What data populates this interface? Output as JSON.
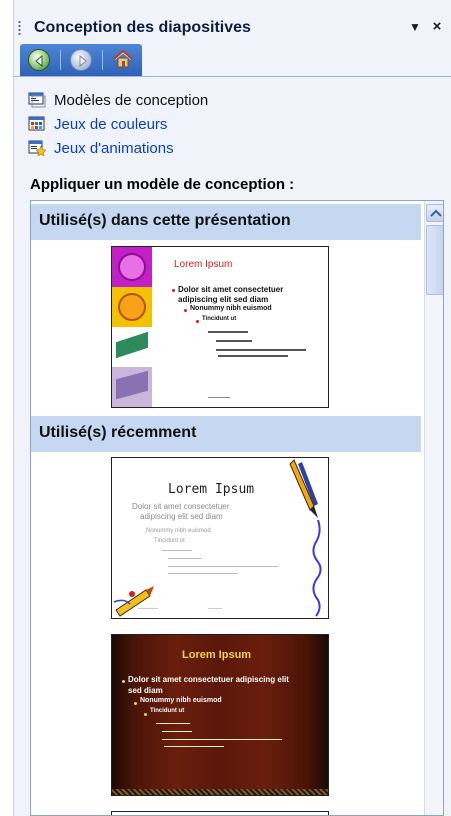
{
  "pane": {
    "title": "Conception des diapositives",
    "dropdown_icon": "dropdown-arrow-icon",
    "close_icon": "close-icon",
    "close_glyph": "×",
    "dropdown_glyph": "▼"
  },
  "nav": {
    "buttons": [
      {
        "name": "back",
        "icon": "back-arrow-icon"
      },
      {
        "name": "forward",
        "icon": "forward-arrow-icon"
      },
      {
        "name": "home",
        "icon": "home-icon"
      }
    ]
  },
  "links": [
    {
      "label": "Modèles de conception",
      "icon": "design-templates-icon"
    },
    {
      "label": "Jeux de couleurs",
      "icon": "color-schemes-icon"
    },
    {
      "label": "Jeux d'animations",
      "icon": "animation-schemes-icon"
    }
  ],
  "apply_heading": "Appliquer un modèle de conception :",
  "gallery": {
    "groups": [
      {
        "label": "Utilisé(s) dans cette présentation"
      },
      {
        "label": "Utilisé(s) récemment"
      }
    ],
    "thumbnails": [
      {
        "title": "Lorem Ipsum",
        "bullets": [
          "Dolor sit amet consectetuer",
          "adipiscing elit sed diam",
          "Nonummy nibh euismod",
          "Tincidunt ut"
        ],
        "accent": "#d31f1f"
      },
      {
        "title": "Lorem Ipsum",
        "bullets": [
          "Dolor sit amet consectetuer",
          "adipiscing elit sed diam",
          "Nonummy nibh euismod",
          "Tincidunt ut"
        ],
        "accent": "#7a7a7a"
      },
      {
        "title": "Lorem Ipsum",
        "bullets": [
          "Dolor sit amet consectetuer adipiscing elit",
          "sed diam",
          "Nonummy nibh euismod",
          "Tincidunt ut"
        ],
        "accent": "#f2d34a"
      }
    ]
  },
  "colors": {
    "pane_bg": "#f1f3fa",
    "nav_bar": "#2f62b8",
    "group_header": "#c5d7f1",
    "link": "#0a3ec2"
  }
}
